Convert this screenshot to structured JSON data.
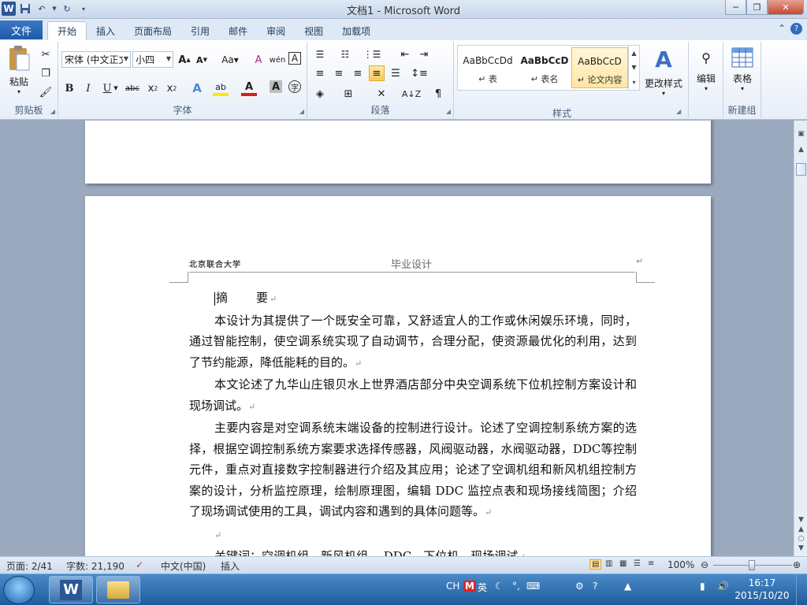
{
  "window": {
    "title": "文档1 - Microsoft Word",
    "app_badge": "W"
  },
  "tabs": {
    "file": "文件",
    "items": [
      "开始",
      "插入",
      "页面布局",
      "引用",
      "邮件",
      "审阅",
      "视图",
      "加载项"
    ],
    "active": "开始"
  },
  "ribbon": {
    "clipboard": {
      "paste_label": "粘贴",
      "group_label": "剪贴板"
    },
    "font": {
      "font_name": "宋体 (中文正文)",
      "font_size": "小四",
      "group_label": "字体"
    },
    "paragraph": {
      "group_label": "段落"
    },
    "styles": {
      "items": [
        {
          "sample": "AaBbCcDd",
          "name": "↵ 表"
        },
        {
          "sample": "AaBbCcD",
          "name": "↵ 表名"
        },
        {
          "sample": "AaBbCcD",
          "name": "↵ 论文内容"
        }
      ],
      "change_styles_label": "更改样式",
      "group_label": "样式"
    },
    "editing": {
      "label": "编辑"
    },
    "table": {
      "label": "表格",
      "group_label": "新建组"
    }
  },
  "document": {
    "header_left": "北京联合大学",
    "header_center": "毕业设计",
    "paragraph_mark": "↵",
    "abstract_title": "摘　　要",
    "paragraphs": [
      "本设计为其提供了一个既安全可靠，又舒适宜人的工作或休闲娱乐环境，同时，通过智能控制，使空调系统实现了自动调节，合理分配，使资源最优化的利用，达到了节约能源，降低能耗的目的。",
      "本文论述了九华山庄银贝水上世界酒店部分中央空调系统下位机控制方案设计和现场调试。",
      "主要内容是对空调系统末端设备的控制进行设计。论述了空调控制系统方案的选择，根据空调控制系统方案要求选择传感器，风阀驱动器，水阀驱动器，DDC等控制元件，重点对直接数字控制器进行介绍及其应用；论述了空调机组和新风机组控制方案的设计，分析监控原理，绘制原理图，编辑 DDC 监控点表和现场接线简图；介绍了现场调试使用的工具，调试内容和遇到的具体问题等。"
    ],
    "keywords": "关键词：空调机组　新风机组　 DDC　下位机　现场调试"
  },
  "statusbar": {
    "page": "页面: 2/41",
    "words": "字数: 21,190",
    "language": "中文(中国)",
    "mode": "插入",
    "zoom": "100%",
    "zoom_level": 1.0
  },
  "taskbar": {
    "ime_lang": "CH",
    "ime_mode": "英",
    "time": "16:17",
    "date": "2015/10/20"
  }
}
